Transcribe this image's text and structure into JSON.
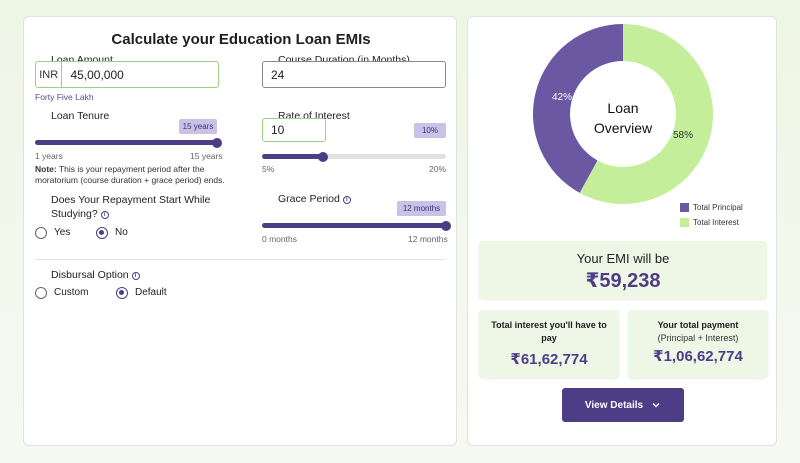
{
  "calculator": {
    "title": "Calculate your Education Loan EMIs",
    "loan_amount": {
      "label": "Loan Amount",
      "prefix": "INR",
      "value": "45,00,000",
      "words": "Forty Five Lakh"
    },
    "course_duration": {
      "label": "Course Duration (in Months)",
      "value": "24"
    },
    "loan_tenure": {
      "label": "Loan Tenure",
      "badge": "15 years",
      "min_label": "1 years",
      "max_label": "15 years",
      "fill": 1.0,
      "note_bold": "Note:",
      "note_line1": "This is your repayment period after the",
      "note_line2": "moratorium (course duration + grace period) ends."
    },
    "rate_of_interest": {
      "label": "Rate of Interest",
      "value": "10",
      "badge": "10%",
      "min_label": "5%",
      "max_label": "20%",
      "fill": 0.333
    },
    "repayment_start": {
      "label_line1": "Does Your Repayment Start While",
      "label_line2": "Studying?",
      "option_yes": "Yes",
      "option_no": "No",
      "selected": "No"
    },
    "grace_period": {
      "label": "Grace Period",
      "badge": "12 months",
      "min_label": "0 months",
      "max_label": "12 months",
      "fill": 1.0
    },
    "disbursal": {
      "label": "Disbursal Option",
      "option_custom": "Custom",
      "option_default": "Default",
      "selected": "Default"
    }
  },
  "overview": {
    "center_line1": "Loan",
    "center_line2": "Overview",
    "principal_pct_label": "42%",
    "interest_pct_label": "58%",
    "principal_fraction": 0.42,
    "legend_principal": "Total Principal",
    "legend_interest": "Total Interest",
    "principal_color": "#6b58a3",
    "interest_color": "#c5ee9b"
  },
  "results": {
    "emi_label": "Your EMI will be",
    "emi_value": "₹59,238",
    "interest_title_line1": "Total interest you'll have to",
    "interest_title_line2": "pay",
    "interest_value": "₹61,62,774",
    "payment_title": "Your total payment",
    "payment_note": "(Principal + Interest)",
    "payment_value": "₹1,06,62,774"
  },
  "actions": {
    "view_details": "View Details"
  },
  "colors": {
    "accent": "#4d3c86",
    "green_border": "#9dd17c",
    "card_bg": "#eef6e6"
  }
}
